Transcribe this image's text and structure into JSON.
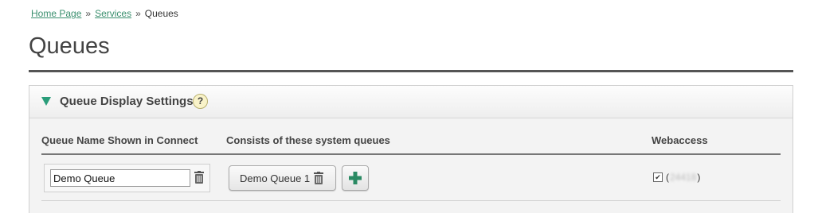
{
  "breadcrumb": {
    "home": "Home Page",
    "sep1": "»",
    "services": "Services",
    "sep2": "»",
    "current": "Queues"
  },
  "page": {
    "title": "Queues"
  },
  "panel": {
    "title": "Queue Display Settings",
    "help_label": "?",
    "columns": {
      "queue_name": "Queue Name Shown in Connect",
      "system_queues": "Consists of these system queues",
      "webaccess": "Webaccess"
    },
    "rows": [
      {
        "queue_name_value": "Demo Queue",
        "system_queue": "Demo Queue 1",
        "webaccess_checked": true,
        "webaccess_open": "(",
        "webaccess_id": "24418",
        "webaccess_close": ")"
      }
    ]
  },
  "colors": {
    "link": "#3a8f6e",
    "accent": "#2a9d7a",
    "plus_icon": "#2a8a63"
  }
}
